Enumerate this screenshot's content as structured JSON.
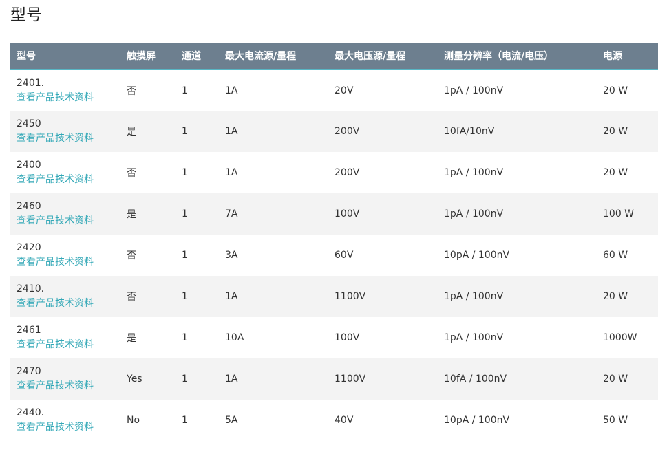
{
  "page": {
    "title": "型号"
  },
  "table": {
    "headers": [
      "型号",
      "触摸屏",
      "通道",
      "最大电流源/量程",
      "最大电压源/量程",
      "测量分辨率（电流/电压）",
      "电源"
    ],
    "link_label": "查看产品技术资料",
    "rows": [
      {
        "model": "2401.",
        "touch": "否",
        "channels": "1",
        "max_current": "1A",
        "max_voltage": "20V",
        "resolution": "1pA / 100nV",
        "power": "20 W"
      },
      {
        "model": "2450",
        "touch": "是",
        "channels": "1",
        "max_current": "1A",
        "max_voltage": "200V",
        "resolution": "10fA/10nV",
        "power": "20 W"
      },
      {
        "model": "2400",
        "touch": "否",
        "channels": "1",
        "max_current": "1A",
        "max_voltage": "200V",
        "resolution": "1pA / 100nV",
        "power": "20 W"
      },
      {
        "model": "2460",
        "touch": "是",
        "channels": "1",
        "max_current": "7A",
        "max_voltage": "100V",
        "resolution": "1pA / 100nV",
        "power": "100 W"
      },
      {
        "model": "2420",
        "touch": "否",
        "channels": "1",
        "max_current": "3A",
        "max_voltage": "60V",
        "resolution": "10pA / 100nV",
        "power": "60 W"
      },
      {
        "model": "2410.",
        "touch": "否",
        "channels": "1",
        "max_current": "1A",
        "max_voltage": "1100V",
        "resolution": "1pA / 100nV",
        "power": "20 W"
      },
      {
        "model": "2461",
        "touch": "是",
        "channels": "1",
        "max_current": "10A",
        "max_voltage": "100V",
        "resolution": "1pA / 100nV",
        "power": "1000W"
      },
      {
        "model": "2470",
        "touch": "Yes",
        "channels": "1",
        "max_current": "1A",
        "max_voltage": "1100V",
        "resolution": "10fA / 100nV",
        "power": "20 W"
      },
      {
        "model": "2440.",
        "touch": "No",
        "channels": "1",
        "max_current": "5A",
        "max_voltage": "40V",
        "resolution": "10pA / 100nV",
        "power": "50 W"
      }
    ]
  },
  "colors": {
    "header_bg": "#6d7f8f",
    "header_border": "#58b6c4",
    "link": "#33a8b7",
    "row_alt": "#f3f3f3"
  }
}
